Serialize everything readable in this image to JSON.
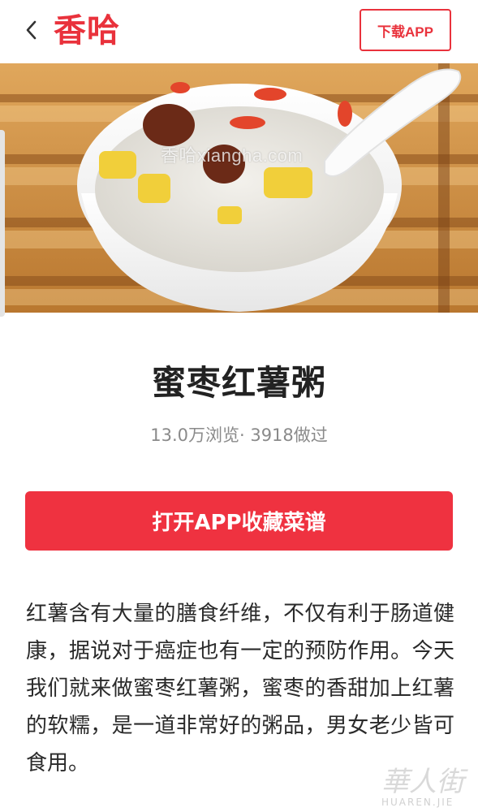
{
  "header": {
    "logo_text": "香哈",
    "download_label": "下载APP",
    "back_icon": "chevron-left-icon"
  },
  "hero": {
    "watermark": "香哈xiangha.com"
  },
  "recipe": {
    "title": "蜜枣红薯粥",
    "stats": "13.0万浏览· 3918做过",
    "cta_label": "打开APP收藏菜谱",
    "description": "红薯含有大量的膳食纤维，不仅有利于肠道健康，据说对于癌症也有一定的预防作用。今天我们就来做蜜枣红薯粥，蜜枣的香甜加上红薯的软糯，是一道非常好的粥品，男女老少皆可食用。"
  },
  "corner_watermark": {
    "script": "華人街",
    "sub": "HUAREN.JIE"
  },
  "colors": {
    "brand_red": "#e9323c",
    "cta_red": "#ef3240",
    "text_dark": "#222222",
    "text_gray": "#8a8a8a"
  }
}
